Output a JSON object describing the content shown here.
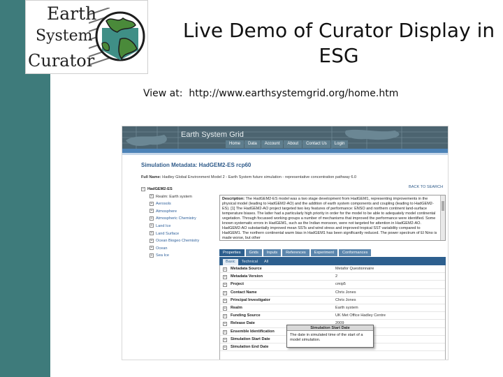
{
  "slide": {
    "title": "Live Demo of Curator Display in ESG",
    "view_at": "View at:  http://www.earthsystemgrid.org/home.htm"
  },
  "logo": {
    "line1": "Earth",
    "line2": "System",
    "line3": "Curator"
  },
  "esg": {
    "site_title": "Earth System Grid",
    "nav": [
      "Home",
      "Data",
      "Account",
      "About",
      "Contact Us",
      "Login"
    ],
    "heading": "Simulation Metadata: HadGEM2-ES rcp60",
    "full_name_label": "Full Name:",
    "full_name_value": "Hadley Global Environment Model 2 - Earth System future simulation - representative concentration pathway 6.0",
    "back_to_search": "BACK TO SEARCH",
    "tree": {
      "root": "HadGEM2-ES",
      "realm": "Realm: Earth system",
      "items": [
        "Aerosols",
        "Atmosphere",
        "Atmospheric Chemistry",
        "Land Ice",
        "Land Surface",
        "Ocean Biogeo Chemistry",
        "Ocean",
        "Sea Ice"
      ]
    },
    "description_label": "Description:",
    "description_text": "The HadGEM2-ES model was a two stage development from HadGEM1, representing improvements in the physical model (leading to HadGEM2-AO) and the addition of earth system components and coupling (leading to HadGEM2-ES). [1] The HadGEM2-AO project targeted two key features of performance: ENSO and northern continent land-surface temperature biases. The latter had a particularly high priority in order for the model to be able to adequately model continental vegetation. Through focussed working groups a number of mechanisms that improved the performance were identified. Some known systematic errors in HadGEM1, such as the Indian monsoon, were not targeted for attention in HadGEM2-AO. HadGEM2-AO substantially improved mean SSTs and wind stress and improved tropical SST variability compared to HadGEM1. The northern continental warm bias in HadGEM1 has been significantly reduced. The power spectrum of El Nino is made worse, but other",
    "tabs": [
      "Properties",
      "Grids",
      "Inputs",
      "References",
      "Experiment",
      "Conformances"
    ],
    "subtabs": [
      "Basic",
      "Technical",
      "All"
    ],
    "metadata": [
      {
        "key": "Metadata Source",
        "value": "Metafor Questionnaire"
      },
      {
        "key": "Metadata Version",
        "value": "2"
      },
      {
        "key": "Project",
        "value": "cmip5"
      },
      {
        "key": "Contact Name",
        "value": "Chris Jones"
      },
      {
        "key": "Principal Investigator",
        "value": "Chris Jones"
      },
      {
        "key": "Realm",
        "value": "Earth system"
      },
      {
        "key": "Funding Source",
        "value": "UK Met Office Hadley Centre"
      },
      {
        "key": "Release Date",
        "value": "2009"
      },
      {
        "key": "Ensemble Identification",
        "value": ""
      },
      {
        "key": "Simulation Start Date",
        "value": ""
      },
      {
        "key": "Simulation End Date",
        "value": ""
      }
    ],
    "tooltip": {
      "title": "Simulation Start Date",
      "body": "The date in simulated time of the start of a model simulation."
    }
  },
  "colors": {
    "left_bar": "#3e7b7b",
    "esg_header": "#4c6470",
    "esg_blue": "#2d5f8e",
    "link_blue": "#2d5f9a"
  }
}
